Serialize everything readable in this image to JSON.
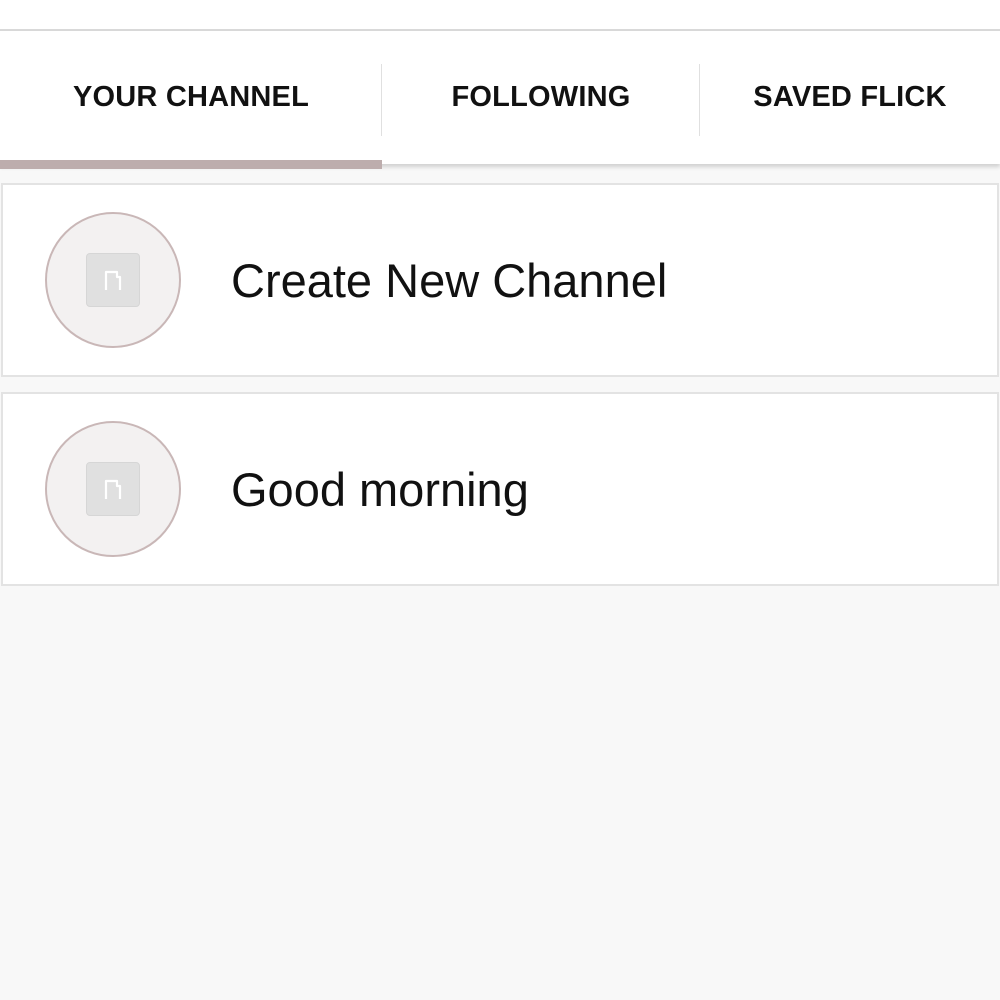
{
  "tabs": [
    {
      "label": "YOUR CHANNEL",
      "selected": true
    },
    {
      "label": "FOLLOWING",
      "selected": false
    },
    {
      "label": "SAVED FLICK",
      "selected": false
    }
  ],
  "channels": [
    {
      "label": "Create New Channel",
      "icon": "image-placeholder-icon"
    },
    {
      "label": "Good morning",
      "icon": "image-placeholder-icon"
    }
  ],
  "colors": {
    "tab_indicator": "#bdadad",
    "avatar_border": "#c9b7b7",
    "background": "#f8f8f8"
  }
}
